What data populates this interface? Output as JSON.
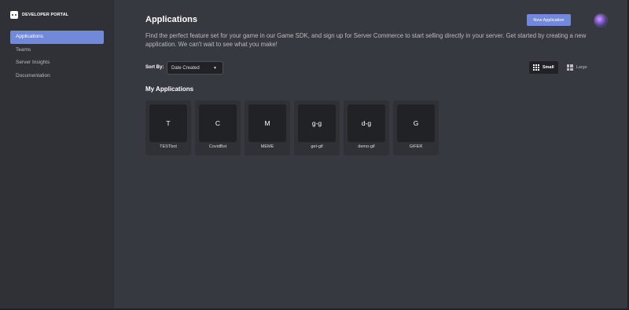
{
  "brand": {
    "name": "DEVELOPER PORTAL",
    "icon": "discord-logo-icon"
  },
  "sidebar": {
    "items": [
      {
        "label": "Applications",
        "active": true
      },
      {
        "label": "Teams",
        "active": false
      },
      {
        "label": "Server Insights",
        "active": false
      },
      {
        "label": "Documentation",
        "active": false
      }
    ]
  },
  "header": {
    "title": "Applications",
    "new_app_label": "New Application",
    "description": "Find the perfect feature set for your game in our Game SDK, and sign up for Server Commerce to start selling directly in your server. Get started by creating a new application. We can't wait to see what you make!"
  },
  "sort": {
    "label": "Sort By:",
    "value": "Date Created"
  },
  "size_toggle": {
    "small_label": "Small",
    "large_label": "Large",
    "selected": "Small"
  },
  "section_title": "My Applications",
  "apps": [
    {
      "initials": "T",
      "name": "TESTbot"
    },
    {
      "initials": "C",
      "name": "CovidBot"
    },
    {
      "initials": "M",
      "name": "MEME"
    },
    {
      "initials": "g-g",
      "name": "get-gif"
    },
    {
      "initials": "d-g",
      "name": "demo-gif"
    },
    {
      "initials": "G",
      "name": "GIFER"
    }
  ],
  "colors": {
    "accent": "#7289da",
    "background": "#36393f",
    "sidebar": "#2f3136",
    "card": "#2f3136",
    "icon_bg": "#202225"
  }
}
